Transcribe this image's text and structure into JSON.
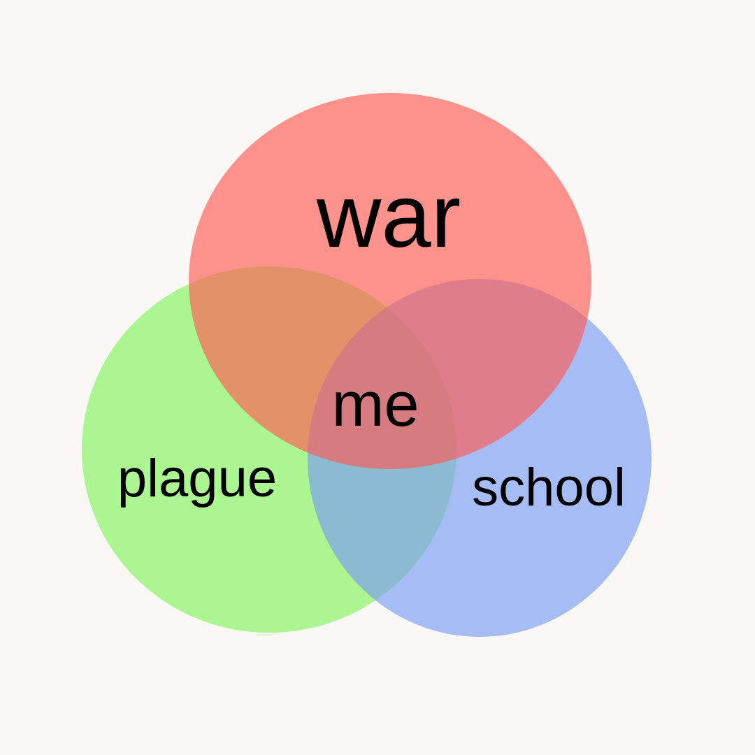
{
  "diagram": {
    "type": "venn",
    "sets": [
      {
        "id": "war",
        "label": "war",
        "color": "#ff5a55"
      },
      {
        "id": "plague",
        "label": "plague",
        "color": "#82f55a"
      },
      {
        "id": "school",
        "label": "school",
        "color": "#7a9bf5"
      }
    ],
    "center_label": "me",
    "fill_opacity": 0.65,
    "background": "#f9f8f5",
    "text_color": "#000000"
  }
}
